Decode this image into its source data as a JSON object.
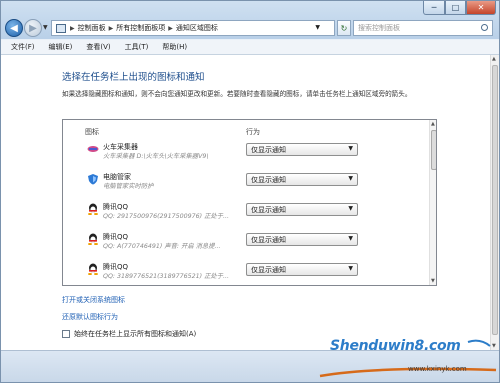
{
  "window": {
    "controls": {
      "minimize": "─",
      "maximize": "□",
      "close": "✕"
    }
  },
  "address_bar": {
    "crumbs": [
      "控制面板",
      "所有控制面板项",
      "通知区域图标"
    ]
  },
  "search": {
    "placeholder": "搜索控制面板"
  },
  "menu": [
    "文件(F)",
    "编辑(E)",
    "查看(V)",
    "工具(T)",
    "帮助(H)"
  ],
  "page": {
    "title": "选择在任务栏上出现的图标和通知",
    "description": "如果选择隐藏图标和通知，则不会向您通知更改和更新。若要随时查看隐藏的图标，请单击任务栏上通知区域旁的箭头。"
  },
  "table": {
    "headers": {
      "icon": "图标",
      "behavior": "行为"
    },
    "rows": [
      {
        "name": "火车采集器",
        "detail": "火车采集器 D:\\火车头\\火车采集器V9\\",
        "behavior": "仅显示通知",
        "icon": "train-collector-icon"
      },
      {
        "name": "电脑管家",
        "detail": "电脑管家实时防护",
        "behavior": "仅显示通知",
        "icon": "shield-icon"
      },
      {
        "name": "腾讯QQ",
        "detail": "QQ: 2917500976(2917500976)  正处于...",
        "behavior": "仅显示通知",
        "icon": "qq-penguin-icon"
      },
      {
        "name": "腾讯QQ",
        "detail": "QQ: A(770746491)  声音: 开启  消息提...",
        "behavior": "仅显示通知",
        "icon": "qq-penguin-icon"
      },
      {
        "name": "腾讯QQ",
        "detail": "QQ: 3189776521(3189776521)  正处于...",
        "behavior": "仅显示通知",
        "icon": "qq-penguin-icon"
      }
    ]
  },
  "links": {
    "system_icons": "打开或关闭系统图标",
    "restore_defaults": "还原默认图标行为"
  },
  "checkbox": {
    "label": "始终在任务栏上显示所有图标和通知(A)",
    "checked": false
  },
  "watermark": {
    "text": "Shenduwin8.com",
    "sub": "www.kxinyk.com"
  },
  "colors": {
    "link": "#1e5fb4",
    "title": "#1e4e8c"
  }
}
